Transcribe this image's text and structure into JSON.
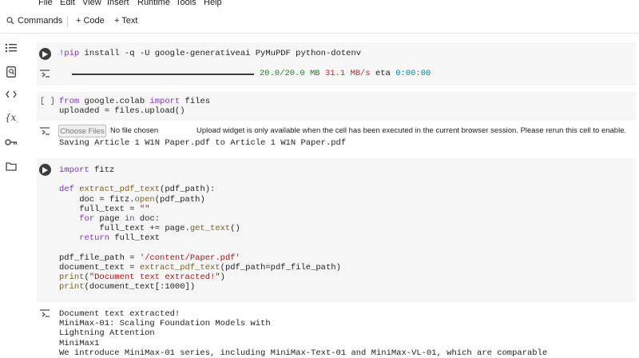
{
  "menubar": {
    "items": [
      "File",
      "Edit",
      "View",
      "Insert",
      "Runtime",
      "Tools",
      "Help"
    ]
  },
  "toolbar": {
    "commands_label": "Commands",
    "code_label": "+ Code",
    "text_label": "+ Text"
  },
  "sidebar": {
    "icons": [
      "toc-icon",
      "find-icon",
      "code-snippets-icon",
      "variables-icon",
      "secrets-key-icon",
      "folder-icon"
    ]
  },
  "cell1": {
    "code": "!pip install -q -U google-generativeai PyMuPDF python-dotenv",
    "progress": {
      "fraction": 1.0,
      "text_size": "20.0/20.0 MB",
      "text_speed": "31.1 MB/s",
      "text_eta_label": "eta",
      "text_eta": "0:00:00"
    }
  },
  "cell2": {
    "bracket": "[ ]",
    "line1": "from google.colab import files",
    "line2": "uploaded = files.upload()",
    "choose_files_label": "Choose Files",
    "no_file_label": "No file chosen",
    "upload_message": "Upload widget is only available when the cell has been executed in the current browser session. Please rerun this cell to enable.",
    "saving_line": "Saving Article 1 W1N Paper.pdf to Article 1 W1N Paper.pdf"
  },
  "cell3": {
    "lines": [
      "import fitz",
      "",
      "def extract_pdf_text(pdf_path):",
      "    doc = fitz.open(pdf_path)",
      "    full_text = \"\"",
      "    for page in doc:",
      "        full_text += page.get_text()",
      "    return full_text",
      "",
      "pdf_file_path = '/content/Paper.pdf'",
      "document_text = extract_pdf_text(pdf_path=pdf_file_path)",
      "print(\"Document text extracted!\")",
      "print(document_text[:1000])"
    ],
    "output": [
      "Document text extracted!",
      "MiniMax-01: Scaling Foundation Models with",
      "Lightning Attention",
      "MiniMax1",
      "We introduce MiniMax-01 series, including MiniMax-Text-01 and MiniMax-VL-01, which are comparable"
    ]
  }
}
